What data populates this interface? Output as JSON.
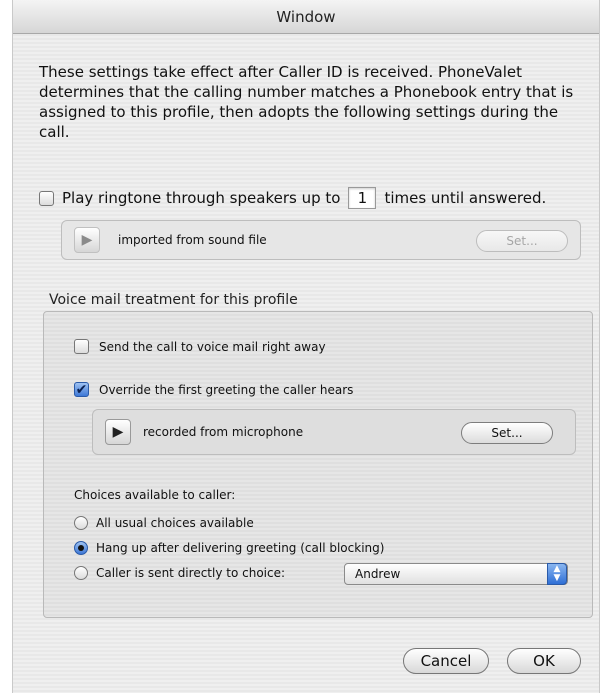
{
  "window": {
    "title": "Window"
  },
  "intro_text": "These settings take effect after Caller ID is received. PhoneValet determines that the calling number matches a Phonebook entry that is assigned to this profile, then adopts the following settings during the call.",
  "ringtone": {
    "label_before": "Play ringtone through speakers up to",
    "times_value": "1",
    "label_after": "times until answered.",
    "checked": false,
    "sound_label": "imported from sound file",
    "set_label": "Set..."
  },
  "voicemail": {
    "group_label": "Voice mail treatment for this profile",
    "send_right_away_label": "Send the call to voice mail right away",
    "override_label": "Override the first greeting the caller hears",
    "override_checked": true,
    "sound_label": "recorded from microphone",
    "set_label": "Set...",
    "choices_label": "Choices available to caller:",
    "choices": [
      "All usual choices available",
      "Hang up after delivering greeting (call blocking)",
      "Caller is sent directly to choice:"
    ],
    "selected_choice_index": 1,
    "choice_popup_value": "Andrew"
  },
  "buttons": {
    "cancel": "Cancel",
    "ok": "OK"
  },
  "icons": {
    "play": "play-icon",
    "checkmark": "checkmark-icon",
    "popup_arrows": "up-down-arrows-icon"
  }
}
